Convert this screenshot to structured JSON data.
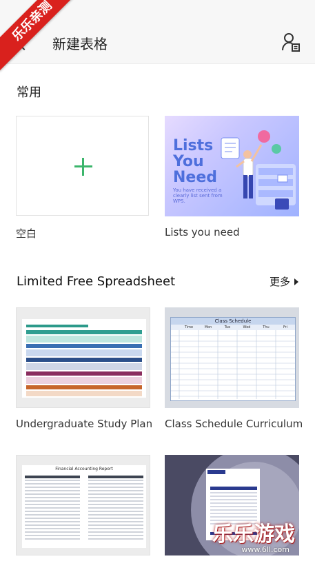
{
  "ribbon_text": "乐乐亲测",
  "header": {
    "title": "新建表格",
    "back_icon": "chevron-left-icon",
    "user_icon": "user-doc-icon"
  },
  "section_common": {
    "title": "常用",
    "items": [
      {
        "label": "空白"
      },
      {
        "label": "Lists you need"
      }
    ]
  },
  "lists_card": {
    "headline": [
      "Lists",
      "You",
      "Need"
    ],
    "sub": "You have received a clearly list sent from WPS."
  },
  "section_free": {
    "title": "Limited Free Spreadsheet",
    "more": "更多",
    "items": [
      {
        "label": "Undergraduate Study Plan"
      },
      {
        "label": "Class Schedule Curriculum"
      }
    ]
  },
  "schedule_thumb": {
    "title": "Class Schedule",
    "headers": [
      "Time",
      "Mon",
      "Tue",
      "Wed",
      "Thu",
      "Fri"
    ]
  },
  "finance_thumb": {
    "title": "Financial Accounting Report"
  },
  "watermark": {
    "main": "乐乐游戏",
    "sub": "www.6ll.com"
  },
  "colors": {
    "accent_green": "#3bb56b",
    "ribbon": "#d9211d"
  }
}
